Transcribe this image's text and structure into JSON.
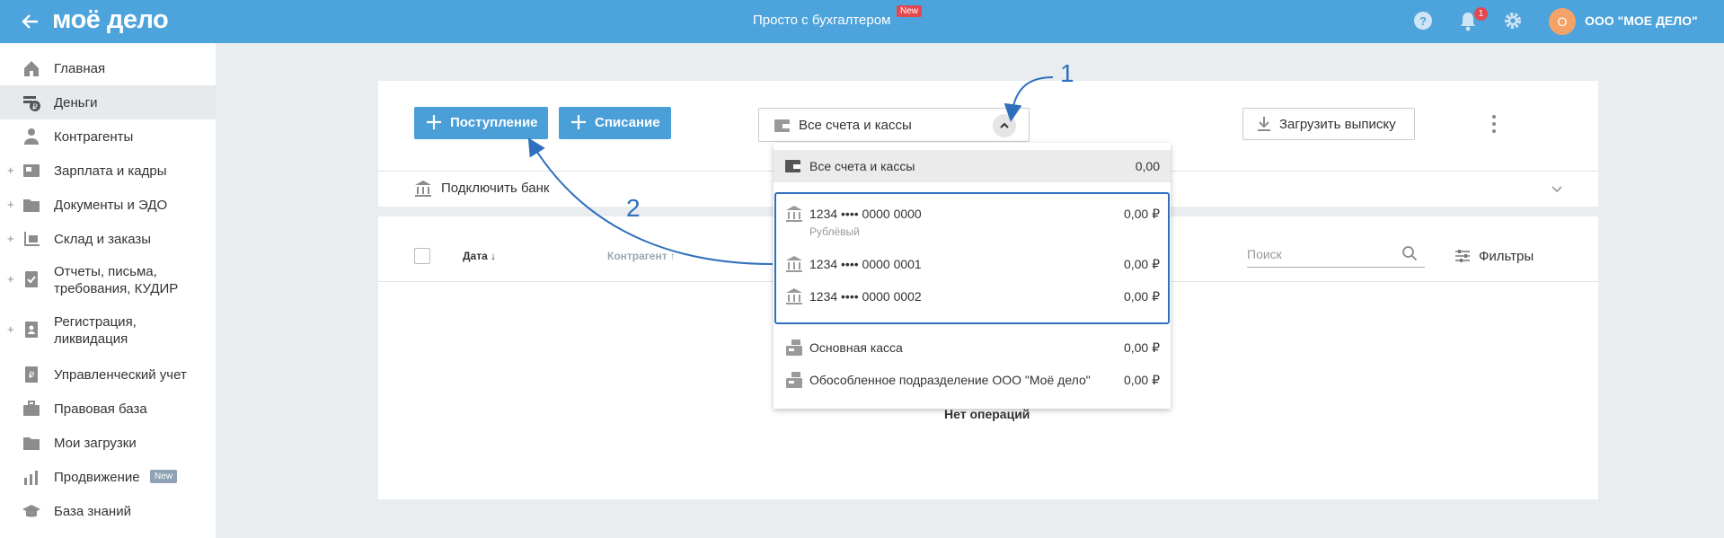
{
  "header": {
    "logo": "моё дело",
    "promo_text": "Просто с бухгалтером",
    "promo_badge": "New",
    "notification_count": "1",
    "avatar_letter": "О",
    "company_name": "ООО \"МОЕ ДЕЛО\"",
    "colors": {
      "bar": "#4da3dc",
      "badge": "#e4484e",
      "avatar": "#f4a267"
    }
  },
  "sidebar": {
    "items": [
      {
        "label": "Главная",
        "icon": "home-icon"
      },
      {
        "label": "Деньги",
        "icon": "money-icon",
        "active": true
      },
      {
        "label": "Контрагенты",
        "icon": "contractors-icon"
      },
      {
        "label": "Зарплата и кадры",
        "icon": "salary-icon",
        "expandable": true
      },
      {
        "label": "Документы и ЭДО",
        "icon": "folder-icon",
        "expandable": true
      },
      {
        "label": "Склад и заказы",
        "icon": "warehouse-icon",
        "expandable": true
      },
      {
        "label": "Отчеты, письма,",
        "label2": "требования, КУДИР",
        "icon": "reports-icon",
        "expandable": true
      },
      {
        "label": "Регистрация,",
        "label2": "ликвидация",
        "icon": "registration-icon",
        "expandable": true
      },
      {
        "label": "Управленческий учет",
        "icon": "management-icon"
      },
      {
        "label": "Правовая база",
        "icon": "briefcase-icon"
      },
      {
        "label": "Мои загрузки",
        "icon": "folder-icon"
      },
      {
        "label": "Продвижение",
        "icon": "chart-icon",
        "badge": "New"
      },
      {
        "label": "База знаний",
        "icon": "graduation-icon"
      }
    ]
  },
  "toolbar": {
    "income_label": "Поступление",
    "expense_label": "Списание",
    "account_select_label": "Все счета и кассы",
    "upload_label": "Загрузить выписку",
    "connect_bank_label": "Подключить банк"
  },
  "table": {
    "headers": {
      "date": "Дата ↓",
      "contractor": "Контрагент ↑"
    },
    "search_placeholder": "Поиск",
    "filters_label": "Фильтры",
    "empty_message": "Нет операций"
  },
  "dropdown": {
    "all": {
      "label": "Все счета и кассы",
      "amount": "0,00"
    },
    "accounts": [
      {
        "label": "1234 •••• 0000 0000",
        "sub": "Рублёвый",
        "amount": "0,00 ₽"
      },
      {
        "label": "1234 •••• 0000 0001",
        "amount": "0,00 ₽"
      },
      {
        "label": "1234 •••• 0000 0002",
        "amount": "0,00 ₽"
      }
    ],
    "cash": [
      {
        "label": "Основная касса",
        "amount": "0,00 ₽"
      },
      {
        "label": "Обособленное подразделение ООО \"Моё дело\"",
        "amount": "0,00 ₽"
      }
    ]
  },
  "annotations": {
    "one": "1",
    "two": "2",
    "color": "#2f6fbd"
  }
}
